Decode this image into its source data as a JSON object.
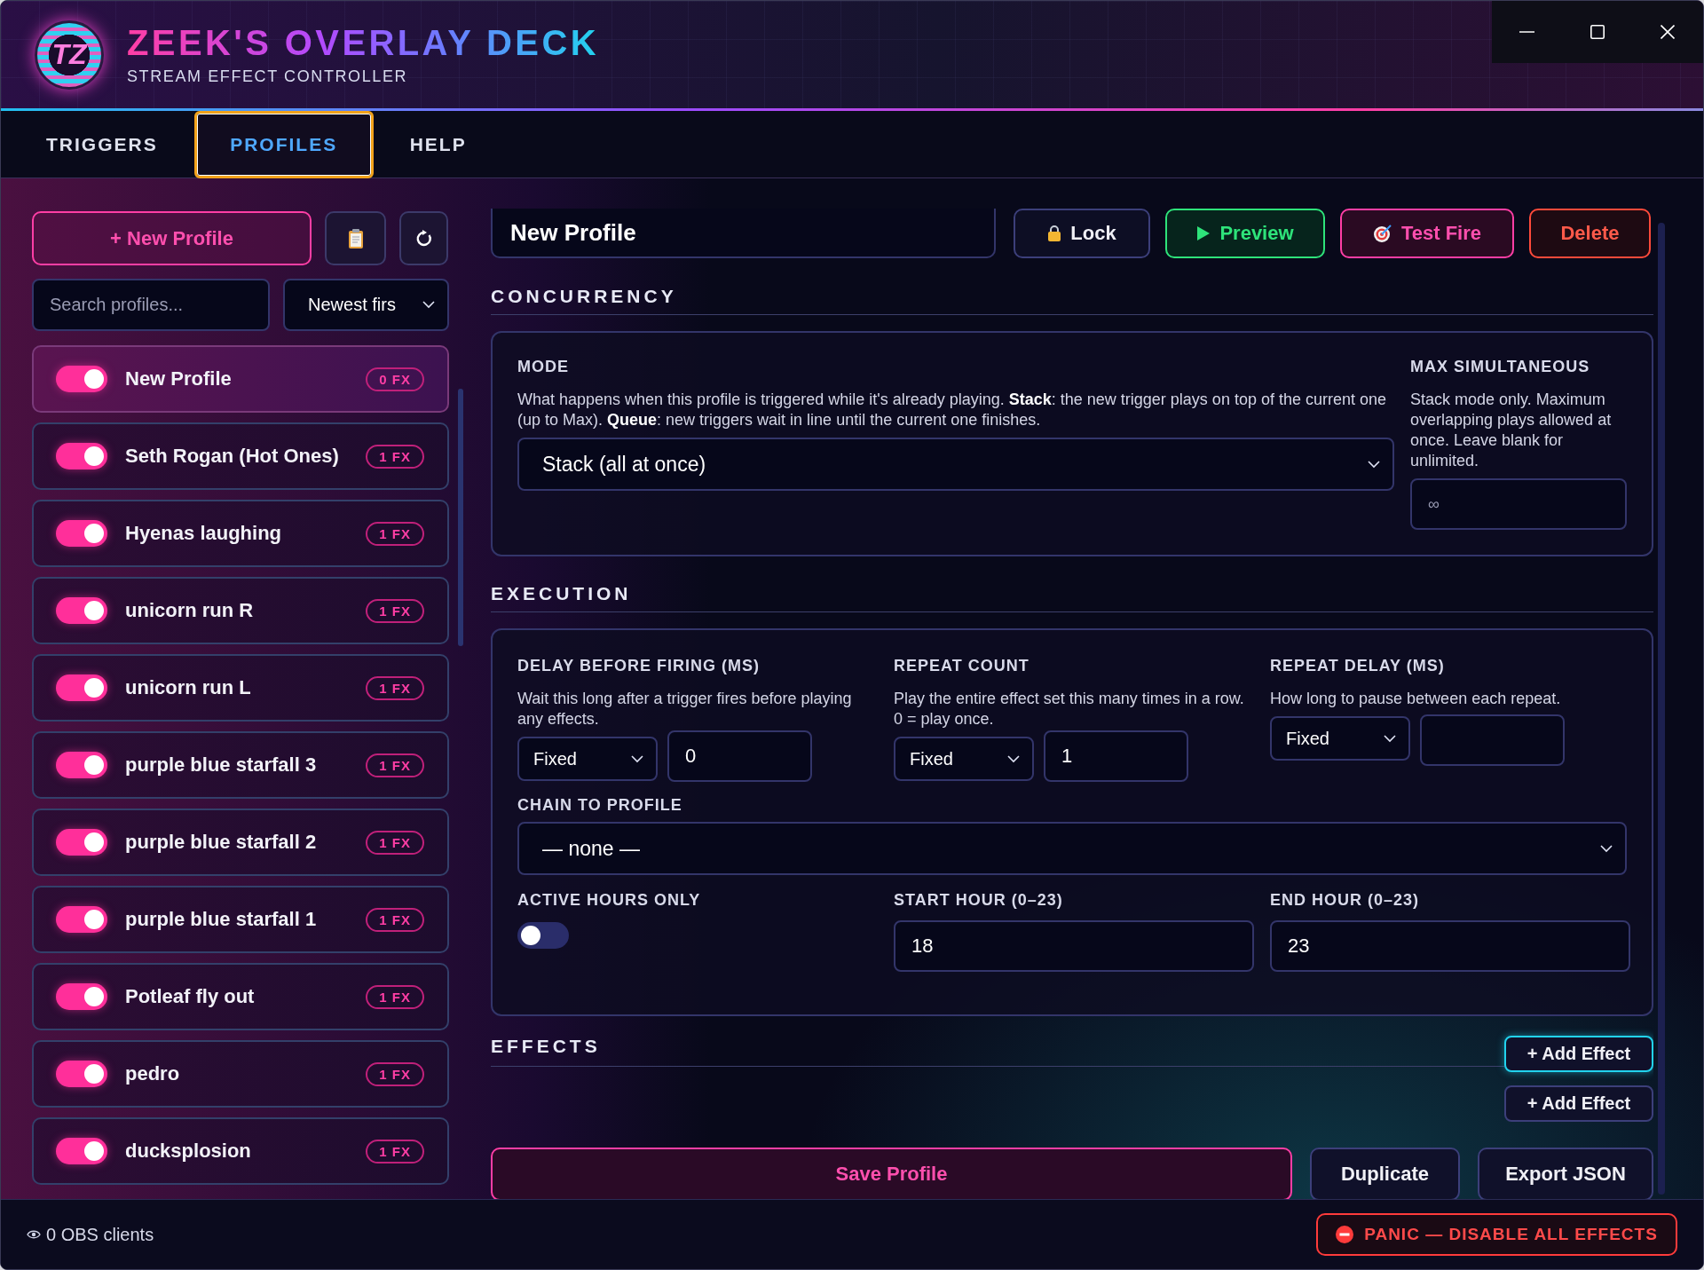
{
  "window": {
    "logo_text": "TZ",
    "title": "ZEEK'S OVERLAY DECK",
    "subtitle": "STREAM EFFECT CONTROLLER"
  },
  "tabs": [
    {
      "label": "TRIGGERS",
      "selected": false
    },
    {
      "label": "PROFILES",
      "selected": true
    },
    {
      "label": "HELP",
      "selected": false
    }
  ],
  "sidebar": {
    "new_profile_button": "+ New Profile",
    "search": {
      "placeholder": "Search profiles..."
    },
    "sort": {
      "value": "Newest firs"
    },
    "profiles": [
      {
        "name": "New Profile",
        "fx": "0 FX",
        "on": true,
        "selected": true
      },
      {
        "name": "Seth Rogan (Hot Ones)",
        "fx": "1 FX",
        "on": true,
        "selected": false
      },
      {
        "name": "Hyenas laughing",
        "fx": "1 FX",
        "on": true,
        "selected": false
      },
      {
        "name": "unicorn run R",
        "fx": "1 FX",
        "on": true,
        "selected": false
      },
      {
        "name": "unicorn run L",
        "fx": "1 FX",
        "on": true,
        "selected": false
      },
      {
        "name": "purple blue starfall 3",
        "fx": "1 FX",
        "on": true,
        "selected": false
      },
      {
        "name": "purple blue starfall 2",
        "fx": "1 FX",
        "on": true,
        "selected": false
      },
      {
        "name": "purple blue starfall 1",
        "fx": "1 FX",
        "on": true,
        "selected": false
      },
      {
        "name": "Potleaf fly out",
        "fx": "1 FX",
        "on": true,
        "selected": false
      },
      {
        "name": "pedro",
        "fx": "1 FX",
        "on": true,
        "selected": false
      },
      {
        "name": "ducksplosion",
        "fx": "1 FX",
        "on": true,
        "selected": false
      }
    ]
  },
  "editor": {
    "name": "New Profile",
    "actions": [
      {
        "label": "Lock",
        "kind": "lock"
      },
      {
        "label": "Preview",
        "kind": "preview"
      },
      {
        "label": "Test Fire",
        "kind": "test"
      },
      {
        "label": "Delete",
        "kind": "delete"
      }
    ],
    "concurrency": {
      "heading": "CONCURRENCY",
      "mode": {
        "label": "MODE",
        "help": "What happens when this profile is triggered while it's already playing. **Stack**: the new trigger plays on top of the current one (up to Max). **Queue**: new triggers wait in line until the current one finishes.",
        "value": "Stack (all at once)"
      },
      "max": {
        "label": "MAX SIMULTANEOUS",
        "help": "Stack mode only. Maximum overlapping plays allowed at once. Leave blank for unlimited.",
        "placeholder": "∞"
      }
    },
    "execution": {
      "heading": "EXECUTION",
      "fields": [
        {
          "label": "DELAY BEFORE FIRING (MS)",
          "help": "Wait this long after a trigger fires before playing any effects.",
          "mode": "Fixed",
          "value": "0"
        },
        {
          "label": "REPEAT COUNT",
          "help": "Play the entire effect set this many times in a row. 0 = play once.",
          "mode": "Fixed",
          "value": "1"
        },
        {
          "label": "REPEAT DELAY (MS)",
          "help": "How long to pause between each repeat.",
          "mode": "Fixed"
        }
      ],
      "chain": {
        "label": "CHAIN TO PROFILE",
        "value": "— none —"
      },
      "active_hours": {
        "label": "ACTIVE HOURS ONLY",
        "on": false
      },
      "start_hour": {
        "label": "START HOUR (0–23)",
        "value": "18"
      },
      "end_hour": {
        "label": "END HOUR (0–23)",
        "value": "23"
      }
    },
    "effects": {
      "heading": "EFFECTS",
      "add_buttons": [
        {
          "label": "+ Add Effect",
          "focused": true
        },
        {
          "label": "+ Add Effect",
          "focused": false
        }
      ]
    },
    "footer_buttons": [
      {
        "label": "Save Profile",
        "kind": "save"
      },
      {
        "label": "Duplicate",
        "kind": "plain"
      },
      {
        "label": "Export JSON",
        "kind": "plain"
      }
    ]
  },
  "status_bar": {
    "clients": "0 OBS clients",
    "panic": "PANIC — DISABLE ALL EFFECTS"
  }
}
